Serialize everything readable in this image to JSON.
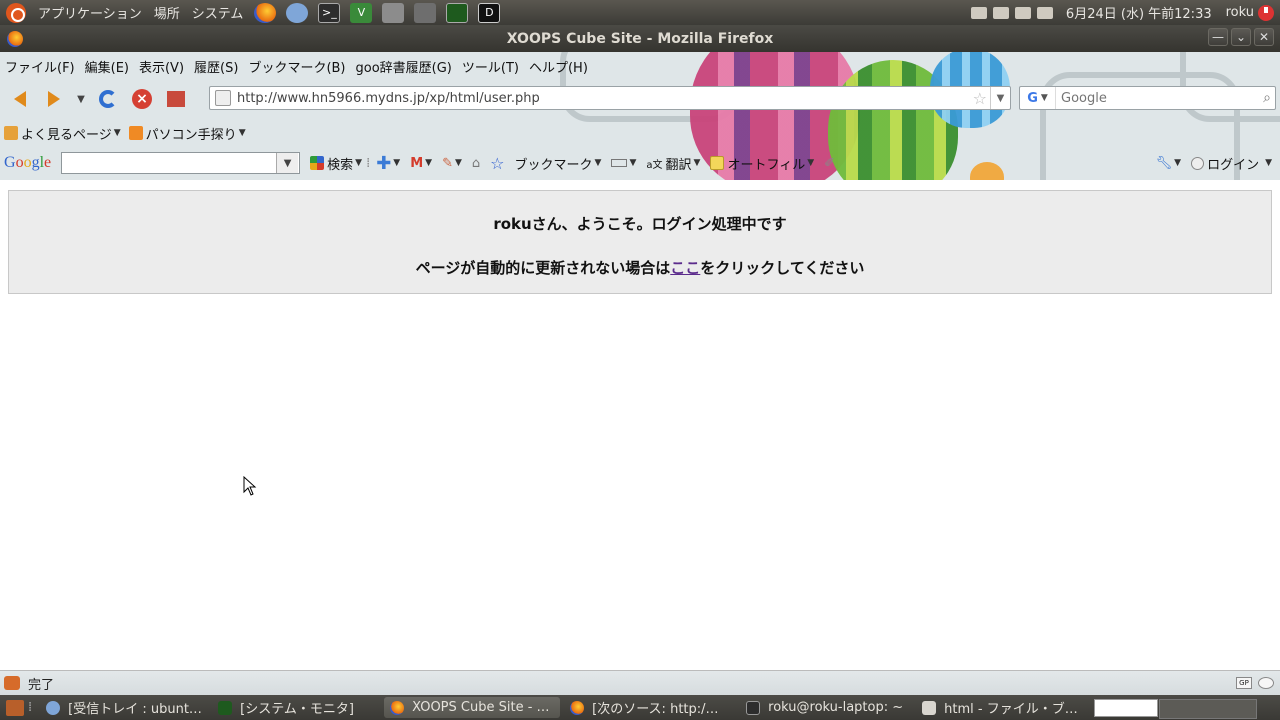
{
  "top_panel": {
    "menus": [
      "アプリケーション",
      "場所",
      "システム"
    ],
    "clock": "6月24日 (水) 午前12:33",
    "user": "roku"
  },
  "window": {
    "title": "XOOPS Cube Site - Mozilla Firefox"
  },
  "menubar": {
    "items": [
      "ファイル(F)",
      "編集(E)",
      "表示(V)",
      "履歴(S)",
      "ブックマーク(B)",
      "goo辞書履歴(G)",
      "ツール(T)",
      "ヘルプ(H)"
    ]
  },
  "navbar": {
    "url": "http://www.hn5966.mydns.jp/xp/html/user.php",
    "search_placeholder": "Google"
  },
  "bookmarks_toolbar": {
    "items": [
      "よく見るページ",
      "パソコン手探り"
    ]
  },
  "google_toolbar": {
    "logo": "Google",
    "search_label": "検索",
    "bookmarks_label": "ブックマーク",
    "translate_label": "翻訳",
    "autofill_label": "オートフィル",
    "login_label": "ログイン"
  },
  "content": {
    "welcome": "rokuさん、ようこそ。ログイン処理中です",
    "redirect_prefix": "ページが自動的に更新されない場合は",
    "redirect_link": "ここ",
    "redirect_suffix": "をクリックしてください"
  },
  "statusbar": {
    "text": "完了"
  },
  "taskbar": {
    "tasks": [
      "[受信トレイ : ubunt…",
      "[システム・モニタ]",
      "XOOPS Cube Site - …",
      "[次のソース: http:/…",
      "roku@roku-laptop: ~",
      "html - ファイル・ブ…"
    ]
  },
  "colors": {
    "accent_orange": "#e08a1b",
    "link_visited": "#5b2b8c",
    "panel_dark": "#3c3b37"
  }
}
